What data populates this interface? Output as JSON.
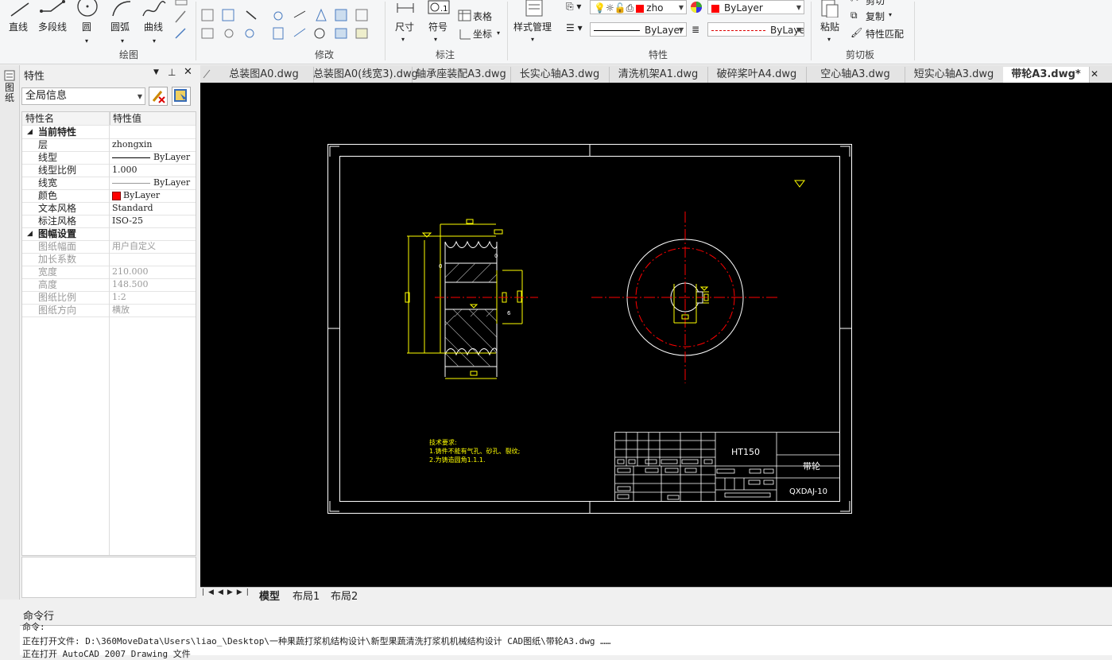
{
  "ribbon": {
    "draw": {
      "line": "直线",
      "polyline": "多段线",
      "circle": "圆",
      "arc": "圆弧",
      "curve": "曲线",
      "group": "绘图"
    },
    "modify_group": "修改",
    "annot": {
      "dim": "尺寸",
      "symbol": "符号",
      "table": "表格",
      "coord": "坐标",
      "group": "标注"
    },
    "style_mgr": "样式管理",
    "props": {
      "layer_value": "zho",
      "color": "ByLayer",
      "linetype": "ByLayer",
      "lineweight": "ByLaye",
      "group": "特性",
      "color_swatch": "#ff0000"
    },
    "clipboard": {
      "paste": "粘贴",
      "cut": "剪切",
      "copy": "复制",
      "match": "特性匹配",
      "group": "剪切板"
    }
  },
  "panel": {
    "title": "特性",
    "strip_label": "图纸",
    "selector": "全局信息",
    "col_name": "特性名",
    "col_value": "特性值",
    "cat_current": "当前特性",
    "cat_sheet": "图幅设置",
    "rows": [
      {
        "name": "层",
        "value": "zhongxin"
      },
      {
        "name": "线型",
        "value": "ByLayer"
      },
      {
        "name": "线型比例",
        "value": "1.000"
      },
      {
        "name": "线宽",
        "value": "ByLayer"
      },
      {
        "name": "颜色",
        "value": "ByLayer"
      },
      {
        "name": "文本风格",
        "value": "Standard"
      },
      {
        "name": "标注风格",
        "value": "ISO-25"
      }
    ],
    "sheet_rows": [
      {
        "name": "图纸幅面",
        "value": "用户自定义"
      },
      {
        "name": "加长系数",
        "value": ""
      },
      {
        "name": "宽度",
        "value": "210.000"
      },
      {
        "name": "高度",
        "value": "148.500"
      },
      {
        "name": "图纸比例",
        "value": "1:2"
      },
      {
        "name": "图纸方向",
        "value": "横放"
      }
    ]
  },
  "tabs": [
    "总装图A0.dwg",
    "总装图A0(线宽3).dwg",
    "轴承座装配A3.dwg",
    "长实心轴A3.dwg",
    "清洗机架A1.dwg",
    "破碎桨叶A4.dwg",
    "空心轴A3.dwg",
    "短实心轴A3.dwg",
    "带轮A3.dwg*"
  ],
  "drawing": {
    "tech_title": "技术要求:",
    "tech_1": "1.铸件不能有气孔、砂孔、裂纹;",
    "tech_2": "2.为铸造圆角1.1.1.",
    "material": "HT150",
    "part_name": "带轮",
    "drawing_no": "QXDAJ-10"
  },
  "layout_tabs": [
    "模型",
    "布局1",
    "布局2"
  ],
  "command": {
    "label": "命令行",
    "line0": "命令:",
    "line1": "正在打开文件: D:\\360MoveData\\Users\\liao_\\Desktop\\一种果蔬打浆机结构设计\\新型果蔬清洗打浆机机械结构设计 CAD图纸\\带轮A3.dwg ……",
    "line2": "正在打开 AutoCAD 2007 Drawing 文件"
  }
}
